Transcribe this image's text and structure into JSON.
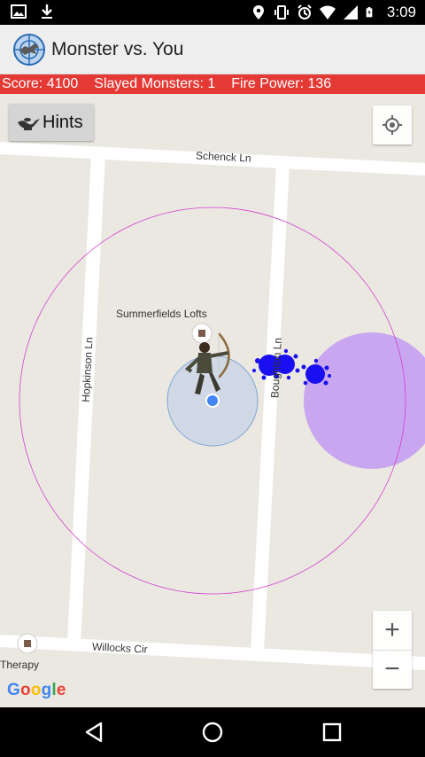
{
  "status_bar": {
    "time": "3:09",
    "left_icons": [
      "image-icon",
      "download-icon"
    ],
    "right_icons": [
      "location-icon",
      "vibrate-icon",
      "alarm-icon",
      "wifi-icon",
      "signal-icon",
      "battery-icon"
    ]
  },
  "app": {
    "title": "Monster vs. You",
    "logo_icon": "crosshair-dragon-icon"
  },
  "stats": {
    "score": "Score: 4100",
    "slayed": "Slayed Monsters: 1",
    "fire_power": "Fire Power: 136"
  },
  "map": {
    "hints_label": "Hints",
    "hints_icon": "magic-lamp-icon",
    "my_location_icon": "my-location-icon",
    "zoom_in": "+",
    "zoom_out": "−",
    "streets": {
      "top": "Schenck Ln",
      "left": "Hopkinson Ln",
      "right": "Boughton Ln",
      "bottom": "Willocks Cir"
    },
    "pois": {
      "lofts": "Summerfields Lofts",
      "therapy": "Therapy"
    },
    "google": "Google",
    "colors": {
      "range_circle": "#d23fd2",
      "monster_blob": "#1a0ff0",
      "monster_zone": "#c9a6f0",
      "player_accuracy": "#aec6e8",
      "player_dot": "#4285f4"
    }
  },
  "nav": {
    "back_icon": "back-icon",
    "home_icon": "home-icon",
    "recents_icon": "recents-icon"
  }
}
